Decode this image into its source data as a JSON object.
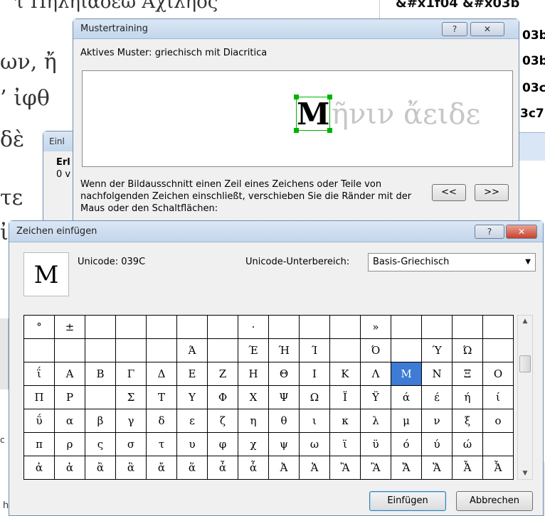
{
  "bg": {
    "left_chars": [
      "ων, ἤ",
      "’ ἰφθ",
      "δὲ",
      "τε",
      "ἰ"
    ],
    "top_text": "τ Πηληϊάδεω Ἀχιλῆος",
    "right_codes": [
      "&#x1f04 &#x03b",
      "03b",
      "03b",
      "03c",
      "3c7"
    ],
    "small_dialog_title": "Einl",
    "small_dialog_bold": "Erl",
    "small_dialog_text": "0 v",
    "left_edge_letters": [
      "c",
      "h"
    ]
  },
  "training": {
    "title": "Mustertraining",
    "help": "?",
    "close": "✕",
    "active_label": "Aktives Muster:",
    "active_value": "griechisch mit Diacritica",
    "glyph": "M",
    "preview_text": "ῆνιν ἄειδε",
    "hint": "Wenn der Bildausschnitt einen Zeil eines Zeichens oder Teile von nachfolgenden Zeichen einschließt, verschieben Sie die Ränder mit der Maus oder den Schaltflächen:",
    "prev_btn": "<<",
    "next_btn": ">>"
  },
  "insert": {
    "title": "Zeichen einfügen",
    "help": "?",
    "close": "✕",
    "preview_char": "M",
    "unicode_label": "Unicode:",
    "unicode_value": "039C",
    "subrange_label": "Unicode-Unterbereich:",
    "subrange_value": "Basis-Griechisch",
    "grid": [
      [
        "°",
        "±",
        "",
        "",
        "",
        "",
        "",
        "·",
        "",
        "",
        "",
        "»",
        "",
        "",
        "",
        ""
      ],
      [
        "",
        "",
        "",
        "",
        "",
        "Ά",
        "",
        "Έ",
        "Ή",
        "Ί",
        "",
        "Ό",
        "",
        "Ύ",
        "Ώ",
        ""
      ],
      [
        "ΐ",
        "Α",
        "Β",
        "Γ",
        "Δ",
        "Ε",
        "Ζ",
        "Η",
        "Θ",
        "Ι",
        "Κ",
        "Λ",
        "Μ",
        "Ν",
        "Ξ",
        "Ο"
      ],
      [
        "Π",
        "Ρ",
        "",
        "Σ",
        "Τ",
        "Υ",
        "Φ",
        "Χ",
        "Ψ",
        "Ω",
        "Ϊ",
        "Ϋ",
        "ά",
        "έ",
        "ή",
        "ί"
      ],
      [
        "ΰ",
        "α",
        "β",
        "γ",
        "δ",
        "ε",
        "ζ",
        "η",
        "θ",
        "ι",
        "κ",
        "λ",
        "μ",
        "ν",
        "ξ",
        "ο"
      ],
      [
        "π",
        "ρ",
        "ς",
        "σ",
        "τ",
        "υ",
        "φ",
        "χ",
        "ψ",
        "ω",
        "ϊ",
        "ϋ",
        "ό",
        "ύ",
        "ώ",
        ""
      ],
      [
        "ἀ",
        "ἁ",
        "ἂ",
        "ἃ",
        "ἄ",
        "ἅ",
        "ἆ",
        "ἇ",
        "Ἀ",
        "Ἁ",
        "Ἂ",
        "Ἃ",
        "Ἄ",
        "Ἅ",
        "Ἆ",
        "Ἇ"
      ]
    ],
    "selected": {
      "row": 2,
      "col": 12
    },
    "insert_btn": "Einfügen",
    "cancel_btn": "Abbrechen"
  }
}
